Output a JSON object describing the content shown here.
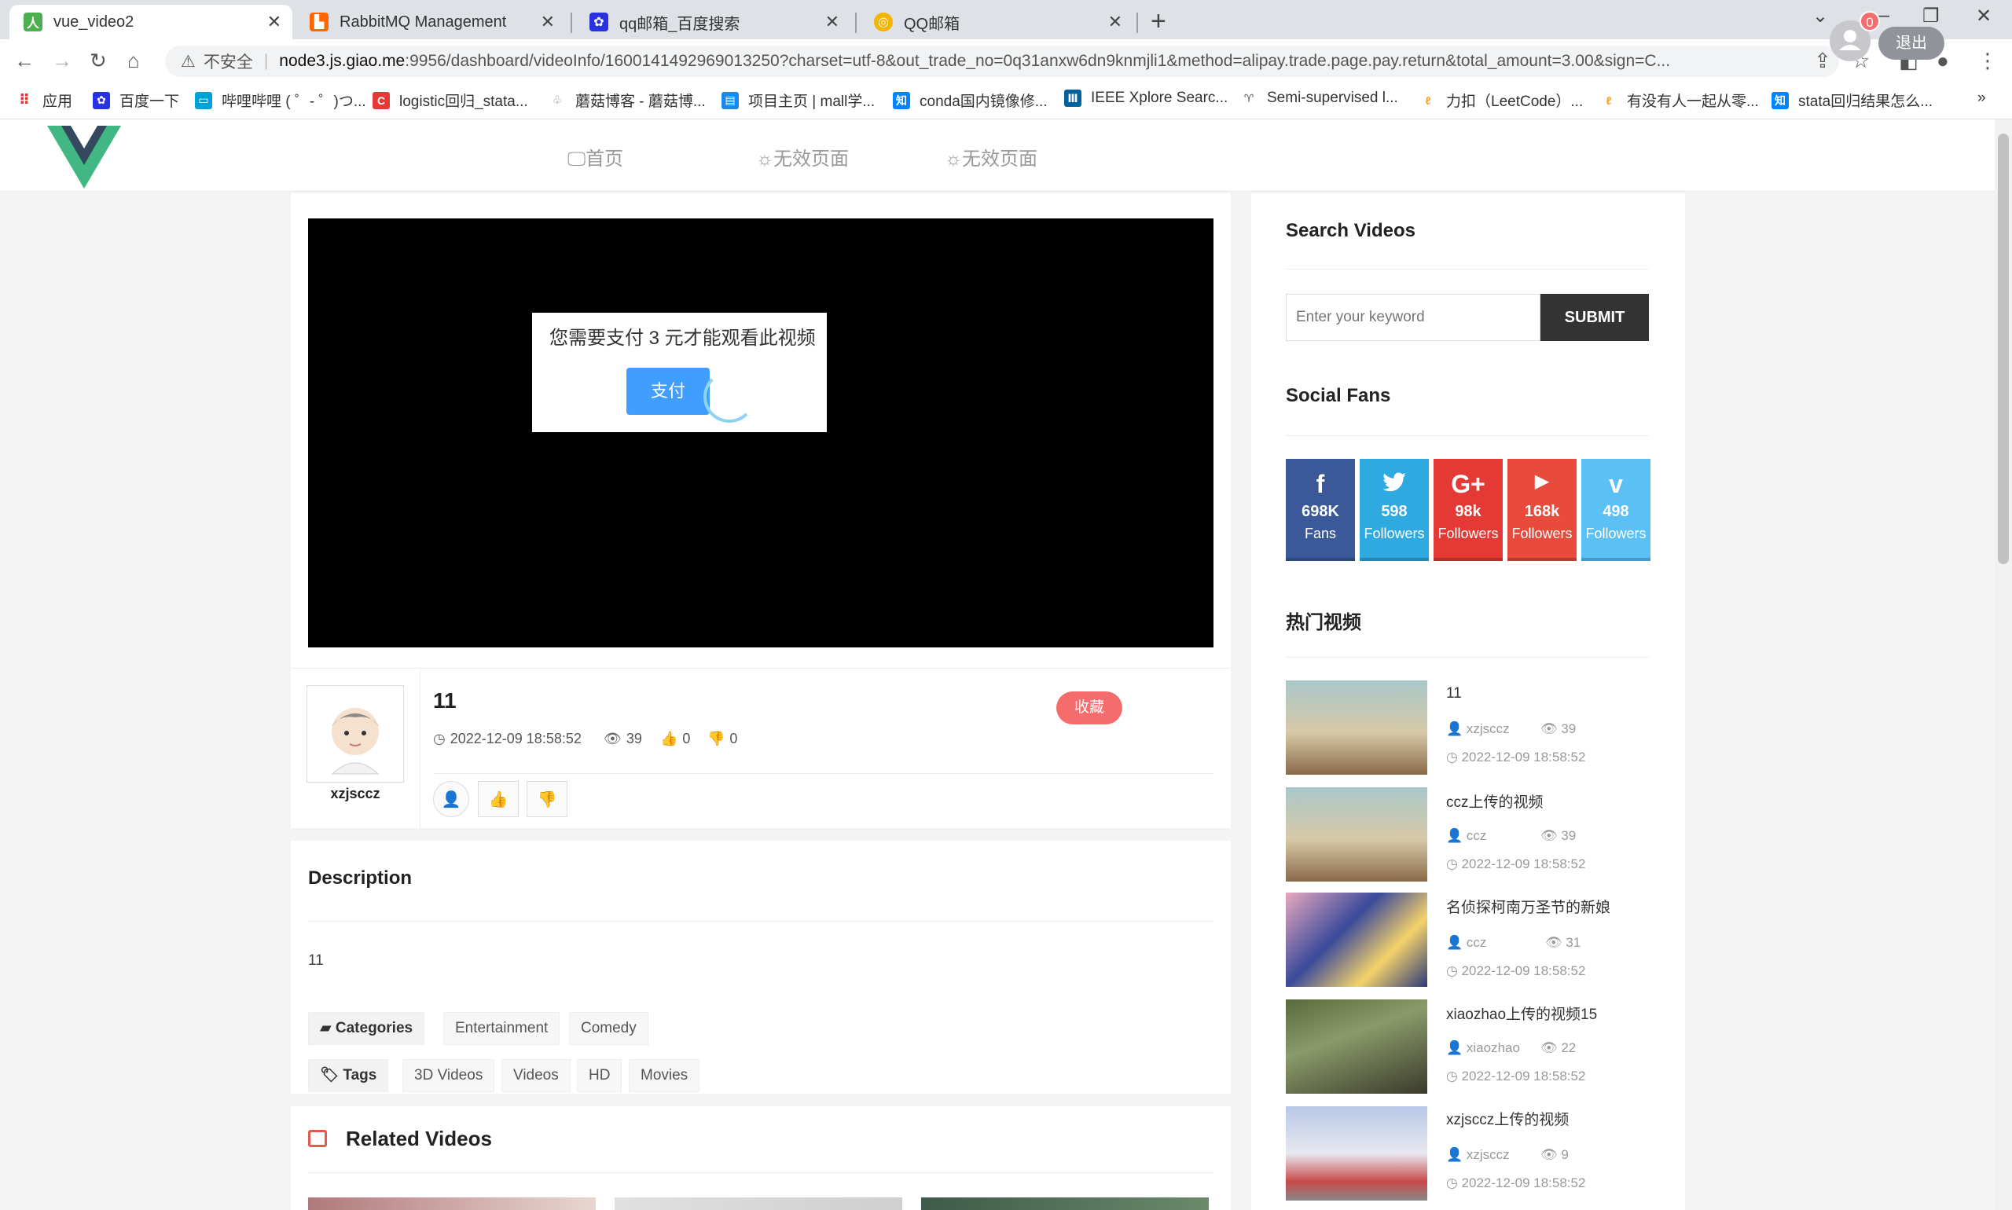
{
  "browser": {
    "tabs": [
      {
        "title": "vue_video2",
        "active": true,
        "color": "#4caf50",
        "glyph": "人"
      },
      {
        "title": "RabbitMQ Management",
        "active": false,
        "color": "#f60",
        "glyph": "▙"
      },
      {
        "title": "qq邮箱_百度搜索",
        "active": false,
        "color": "#2932e1",
        "glyph": "✿"
      },
      {
        "title": "QQ邮箱",
        "active": false,
        "color": "#f4b400",
        "glyph": "◎"
      }
    ],
    "insecure_label": "不安全",
    "url_host": "node3.js.giao.me",
    "url_path": ":9956/dashboard/videoInfo/1600141492969013250?charset=utf-8&out_trade_no=0q31anxw6dn9knmjli1&method=alipay.trade.page.pay.return&total_amount=3.00&sign=C...",
    "bookmarks": [
      {
        "label": "应用",
        "color": "#e53935"
      },
      {
        "label": "百度一下",
        "color": "#2932e1"
      },
      {
        "label": "哔哩哔哩 ( ゜- ゜)つ...",
        "color": "#00a1d6"
      },
      {
        "label": "logistic回归_stata...",
        "color": "#e53935"
      },
      {
        "label": "蘑菇博客 - 蘑菇博...",
        "color": "#888888"
      },
      {
        "label": "项目主页 | mall学...",
        "color": "#1e88e5"
      },
      {
        "label": "conda国内镜像修...",
        "color": "#0084ff"
      },
      {
        "label": "IEEE Xplore Searc...",
        "color": "#00629b"
      },
      {
        "label": "Semi-supervised l...",
        "color": "#555555"
      },
      {
        "label": "力扣（LeetCode）...",
        "color": "#f89f1b"
      },
      {
        "label": "有没有人一起从零...",
        "color": "#f89f1b"
      },
      {
        "label": "stata回归结果怎么...",
        "color": "#0084ff"
      }
    ]
  },
  "header": {
    "nav": [
      {
        "label": "首页",
        "icon": "monitor-icon"
      },
      {
        "label": "无效页面",
        "icon": "sun-icon"
      },
      {
        "label": "无效页面",
        "icon": "sun-icon"
      }
    ],
    "badge": "0",
    "logout": "退出"
  },
  "player": {
    "pay_message": "您需要支付 3 元才能观看此视频",
    "pay_button": "支付"
  },
  "video": {
    "uploader": "xzjsccz",
    "title": "11",
    "collect": "收藏",
    "date": "2022-12-09 18:58:52",
    "views": "39",
    "likes": "0",
    "dislikes": "0"
  },
  "description": {
    "heading": "Description",
    "text": "11",
    "categories_label": "Categories",
    "categories": [
      "Entertainment",
      "Comedy"
    ],
    "tags_label": "Tags",
    "tags": [
      "3D Videos",
      "Videos",
      "HD",
      "Movies"
    ]
  },
  "related": {
    "heading": "Related Videos"
  },
  "sidebar": {
    "search_heading": "Search Videos",
    "search_placeholder": "Enter your keyword",
    "submit": "SUBMIT",
    "social_heading": "Social Fans",
    "social": [
      {
        "icon": "facebook-icon",
        "glyph": "f",
        "count": "698K",
        "label": "Fans",
        "color": "#3b5998"
      },
      {
        "icon": "twitter-icon",
        "glyph": "🐦",
        "count": "598",
        "label": "Followers",
        "color": "#2eaae0"
      },
      {
        "icon": "google-plus-icon",
        "glyph": "G+",
        "count": "98k",
        "label": "Followers",
        "color": "#e53935"
      },
      {
        "icon": "youtube-icon",
        "glyph": "▶",
        "count": "168k",
        "label": "Followers",
        "color": "#e84a3c"
      },
      {
        "icon": "vimeo-icon",
        "glyph": "v",
        "count": "498",
        "label": "Followers",
        "color": "#5ac0f5"
      }
    ],
    "hot_heading": "热门视频",
    "hot": [
      {
        "title": "11",
        "author": "xzjsccz",
        "views": "39",
        "date": "2022-12-09 18:58:52"
      },
      {
        "title": "ccz上传的视频",
        "author": "ccz",
        "views": "39",
        "date": "2022-12-09 18:58:52"
      },
      {
        "title": "名侦探柯南万圣节的新娘",
        "author": "ccz",
        "views": "31",
        "date": "2022-12-09 18:58:52"
      },
      {
        "title": "xiaozhao上传的视频15",
        "author": "xiaozhao",
        "views": "22",
        "date": "2022-12-09 18:58:52"
      },
      {
        "title": "xzjsccz上传的视频",
        "author": "xzjsccz",
        "views": "9",
        "date": "2022-12-09 18:58:52"
      }
    ]
  }
}
